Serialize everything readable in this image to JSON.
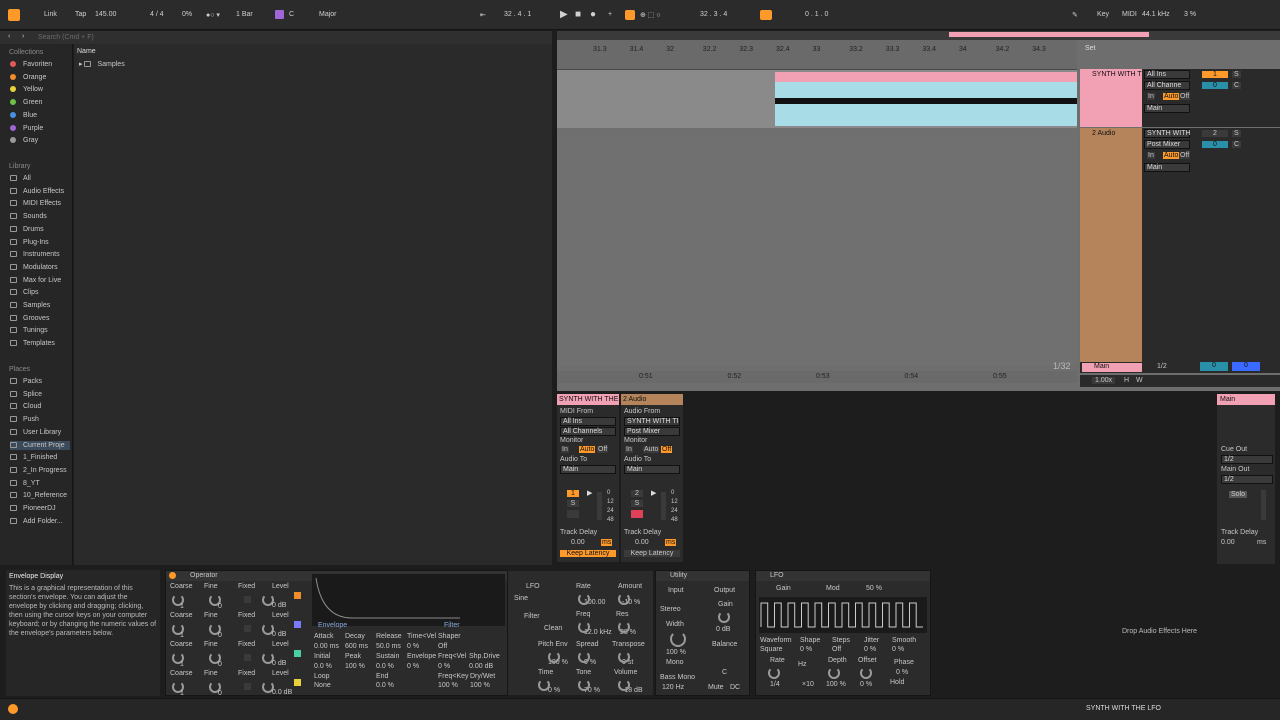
{
  "toolbar": {
    "link": "Link",
    "tap": "Tap",
    "tempo": "145.00",
    "signature": "4 / 4",
    "cpu_meter": "0%",
    "quantize": "1 Bar",
    "key_root": "C",
    "key_scale": "Major",
    "position": "32 .   4 .   1",
    "loop_start": "32 .   3 .   4",
    "loop_length": "0 .   1 .   0",
    "key_label": "Key",
    "midi_label": "MIDI",
    "sample_rate": "44.1 kHz",
    "cpu": "3 %"
  },
  "sidebar": {
    "search_placeholder": "Search (Cmd + F)",
    "collections_title": "Collections",
    "collections": [
      {
        "label": "Favoriten",
        "color": "#e05a5a"
      },
      {
        "label": "Orange",
        "color": "#f08c2c"
      },
      {
        "label": "Yellow",
        "color": "#e8d23c"
      },
      {
        "label": "Green",
        "color": "#6cc04a"
      },
      {
        "label": "Blue",
        "color": "#4a8ee0"
      },
      {
        "label": "Purple",
        "color": "#a066d8"
      },
      {
        "label": "Gray",
        "color": "#9a9a9a"
      }
    ],
    "library_title": "Library",
    "library": [
      "All",
      "Audio Effects",
      "MIDI Effects",
      "Sounds",
      "Drums",
      "Plug-Ins",
      "Instruments",
      "Modulators",
      "Max for Live",
      "Clips",
      "Samples",
      "Grooves",
      "Tunings",
      "Templates"
    ],
    "places_title": "Places",
    "places": [
      "Packs",
      "Splice",
      "Cloud",
      "Push",
      "User Library",
      "Current Proje",
      "1_Finished",
      "2_In Progress",
      "8_YT",
      "10_Reference",
      "PioneerDJ",
      "Add Folder..."
    ]
  },
  "browser": {
    "column_name": "Name",
    "items": [
      "Samples"
    ]
  },
  "arrangement": {
    "ruler": [
      "31.3",
      "31.4",
      "32",
      "32.2",
      "32.3",
      "32.4",
      "33",
      "33.2",
      "33.3",
      "33.4",
      "34",
      "34.2",
      "34.3"
    ],
    "time_ruler": [
      "0:51",
      "0:52",
      "0:53",
      "0:54",
      "0:55"
    ],
    "set_label": "Set",
    "grid": "1/32",
    "zoom": "1.00x",
    "h": "H",
    "w": "W",
    "tracks": [
      {
        "name": "SYNTH WITH T",
        "input": "All Ins",
        "channel": "All Channe",
        "monitor": [
          "In",
          "Auto",
          "Off"
        ],
        "output": "Main",
        "number": "1",
        "s": "S",
        "volume": "0",
        "pan": "C",
        "color": "#f2a0b4"
      },
      {
        "name": "2 Audio",
        "input": "SYNTH WITH",
        "channel": "Post Mixer",
        "monitor": [
          "In",
          "Auto",
          "Off"
        ],
        "output": "Main",
        "number": "2",
        "s": "S",
        "volume": "0",
        "pan": "C",
        "color": "#b5845a"
      }
    ],
    "main": {
      "name": "Main",
      "fraction": "1/2",
      "vol": "0",
      "pan": "0"
    }
  },
  "mixer": {
    "tracks": [
      {
        "name": "SYNTH WITH THE",
        "midi_from": "MIDI From",
        "from_val": "All Ins",
        "channel": "All Channels",
        "monitor": "Monitor",
        "mon_btns": [
          "In",
          "Auto",
          "Off"
        ],
        "audio_to": "Audio To",
        "to_val": "Main",
        "delay_label": "Track Delay",
        "delay": "0.00",
        "unit": "ms",
        "latency": "Keep Latency",
        "num": "1",
        "s": "S",
        "scale": [
          "0",
          "12",
          "24",
          "48"
        ]
      },
      {
        "name": "2 Audio",
        "midi_from": "Audio From",
        "from_val": "SYNTH WITH TI",
        "channel": "Post Mixer",
        "monitor": "Monitor",
        "mon_btns": [
          "In",
          "Auto",
          "Off"
        ],
        "audio_to": "Audio To",
        "to_val": "Main",
        "delay_label": "Track Delay",
        "delay": "0.00",
        "unit": "ms",
        "latency": "Keep Latency",
        "num": "2",
        "s": "S",
        "scale": [
          "0",
          "12",
          "24",
          "48"
        ]
      }
    ],
    "main": {
      "name": "Main",
      "cue_out": "Cue Out",
      "cue_val": "1/2",
      "main_out": "Main Out",
      "main_val": "1/2",
      "solo": "Solo",
      "delay_label": "Track Delay",
      "delay": "0.00",
      "unit": "ms"
    }
  },
  "info": {
    "title": "Envelope Display",
    "text": "This is a graphical representation of this section's envelope. You can adjust the envelope by clicking and dragging; clicking, then using the cursor keys on your computer keyboard; or by changing the numeric values of the envelope's parameters below."
  },
  "operator": {
    "title": "Operator",
    "osc_headers": [
      "Coarse",
      "Fine",
      "Fixed",
      "Level"
    ],
    "oscs": [
      {
        "coarse": "1",
        "fine": "0",
        "level": "0 dB",
        "color": "#f08c2c"
      },
      {
        "coarse": "1",
        "fine": "0",
        "level": "0 dB",
        "color": "#7a7aff"
      },
      {
        "coarse": "1",
        "fine": "0",
        "level": "0 dB",
        "color": "#4ad0a0"
      },
      {
        "coarse": "1",
        "fine": "0",
        "level": "0.0 dB",
        "color": "#e8d23c"
      }
    ],
    "tabs": [
      "Envelope",
      "Filter"
    ],
    "env_labels": [
      "Attack",
      "Decay",
      "Release",
      "Time<Vel",
      "Shaper"
    ],
    "env_values": [
      "0.00 ms",
      "600 ms",
      "50.0 ms",
      "0 %",
      "Off"
    ],
    "env2_labels": [
      "Initial",
      "Peak",
      "Sustain",
      "Envelope",
      "Freq<Vel",
      "Shp.Drive"
    ],
    "env2_values": [
      "0.0 %",
      "100 %",
      "0.0 %",
      "0 %",
      "0 %",
      "0.00 dB"
    ],
    "loop_label": "Loop",
    "loop_val": "None",
    "end_label": "End",
    "end_val": "0.0 %",
    "fk_label": "Freq<Key",
    "fk_val": "100 %",
    "dw_label": "Dry/Wet",
    "dw_val": "100 %",
    "lfo": "LFO",
    "lfo_wave": "Sine",
    "rate": "Rate",
    "rate_val": "100.00",
    "amount": "Amount",
    "amount_val": "-10 %",
    "filter": "Filter",
    "filter_type": "Clean",
    "freq": "Freq",
    "freq_val": "12.0 kHz",
    "res": "Res",
    "res_val": "28 %",
    "pitch_env": "Pitch Env",
    "pitch_env_val": "100 %",
    "spread": "Spread",
    "spread_val": "0 %",
    "transpose": "Transpose",
    "transpose_val": "0 st",
    "time": "Time",
    "time_val": "0 %",
    "tone": "Tone",
    "tone_val": "70 %",
    "volume": "Volume",
    "volume_val": "-18 dB"
  },
  "utility": {
    "title": "Utility",
    "input": "Input",
    "output": "Output",
    "mode": "Stereo",
    "gain": "Gain",
    "gain_val": "0 dB",
    "width": "Width",
    "width_val": "100 %",
    "mono": "Mono",
    "balance": "Balance",
    "balance_val": "C",
    "bass_mono": "Bass Mono",
    "bass_freq": "120 Hz",
    "mute": "Mute",
    "dc": "DC"
  },
  "lfo": {
    "title": "LFO",
    "gain": "Gain",
    "mod": "Mod",
    "pct": "50 %",
    "waveform": "Waveform",
    "waveform_val": "Square",
    "shape": "Shape",
    "shape_val": "0 %",
    "steps": "Steps",
    "steps_val": "Off",
    "jitter": "Jitter",
    "jitter_val": "0 %",
    "smooth": "Smooth",
    "smooth_val": "0 %",
    "rate": "Rate",
    "rate_val": "1/4",
    "hz": "Hz",
    "depth": "Depth",
    "depth_val": "100 %",
    "offset": "Offset",
    "offset_val": "0 %",
    "phase": "Phase",
    "phase_val": "0 %",
    "hold": "Hold",
    "mult": "×10"
  },
  "drop": "Drop Audio Effects Here",
  "status": {
    "track": "SYNTH WITH THE LFO"
  }
}
